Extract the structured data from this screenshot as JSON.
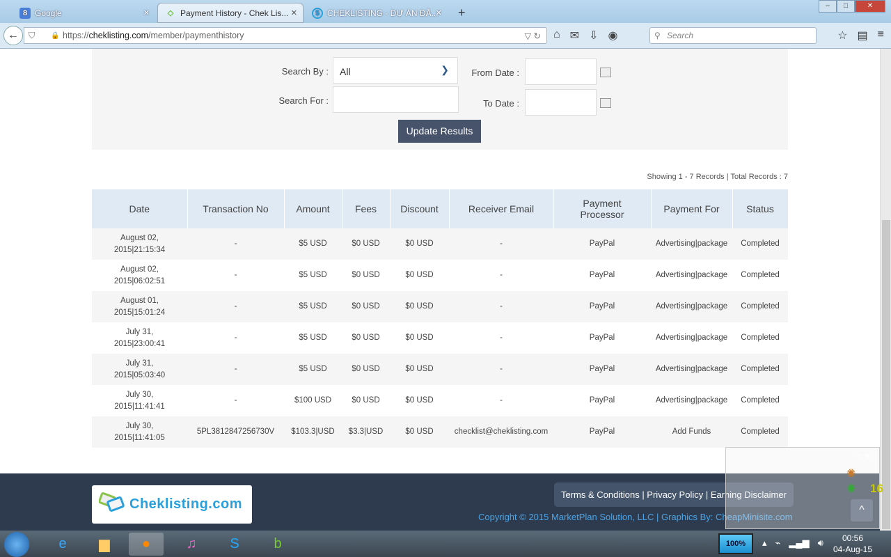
{
  "browser": {
    "tabs": [
      {
        "title": "Google",
        "icon": "google-icon"
      },
      {
        "title": "Payment History - Chek Lis...",
        "icon": "cheklisting-icon"
      },
      {
        "title": "CHEKLISTING - DỰ ÁN ĐẦ...",
        "icon": "dollar-icon"
      }
    ],
    "url_prefix": "https://",
    "url_domain": "cheklisting.com",
    "url_path": "/member/paymenthistory",
    "search_placeholder": "Search"
  },
  "filter": {
    "search_by_label": "Search By :",
    "search_by_value": "All",
    "search_for_label": "Search For :",
    "from_date_label": "From Date :",
    "to_date_label": "To Date :",
    "update_button": "Update Results"
  },
  "showing": "Showing 1 - 7 Records | Total Records : 7",
  "table": {
    "headers": [
      "Date",
      "Transaction No",
      "Amount",
      "Fees",
      "Discount",
      "Receiver Email",
      "Payment Processor",
      "Payment For",
      "Status"
    ],
    "rows": [
      [
        "August 02, 2015|21:15:34",
        "-",
        "$5 USD",
        "$0 USD",
        "$0 USD",
        "-",
        "PayPal",
        "Advertising|package",
        "Completed"
      ],
      [
        "August 02, 2015|06:02:51",
        "-",
        "$5 USD",
        "$0 USD",
        "$0 USD",
        "-",
        "PayPal",
        "Advertising|package",
        "Completed"
      ],
      [
        "August 01, 2015|15:01:24",
        "-",
        "$5 USD",
        "$0 USD",
        "$0 USD",
        "-",
        "PayPal",
        "Advertising|package",
        "Completed"
      ],
      [
        "July 31, 2015|23:00:41",
        "-",
        "$5 USD",
        "$0 USD",
        "$0 USD",
        "-",
        "PayPal",
        "Advertising|package",
        "Completed"
      ],
      [
        "July 31, 2015|05:03:40",
        "-",
        "$5 USD",
        "$0 USD",
        "$0 USD",
        "-",
        "PayPal",
        "Advertising|package",
        "Completed"
      ],
      [
        "July 30, 2015|11:41:41",
        "-",
        "$100 USD",
        "$0 USD",
        "$0 USD",
        "-",
        "PayPal",
        "Advertising|package",
        "Completed"
      ],
      [
        "July 30, 2015|11:41:05",
        "5PL3812847256730V",
        "$103.3|USD",
        "$3.3|USD",
        "$0 USD",
        "checklist@cheklisting.com",
        "PayPal",
        "Add Funds",
        "Completed"
      ]
    ]
  },
  "footer": {
    "logo_text": "Cheklisting.com",
    "links": "Terms & Conditions | Privacy Policy | Earning Disclaimer",
    "copyright": "Copyright © 2015 MarketPlan Solution, LLC | Graphics By: CheapMinisite.com"
  },
  "widget": {
    "count": "16"
  },
  "taskbar": {
    "battery": "100%",
    "time": "00:56",
    "date": "04-Aug-15"
  }
}
